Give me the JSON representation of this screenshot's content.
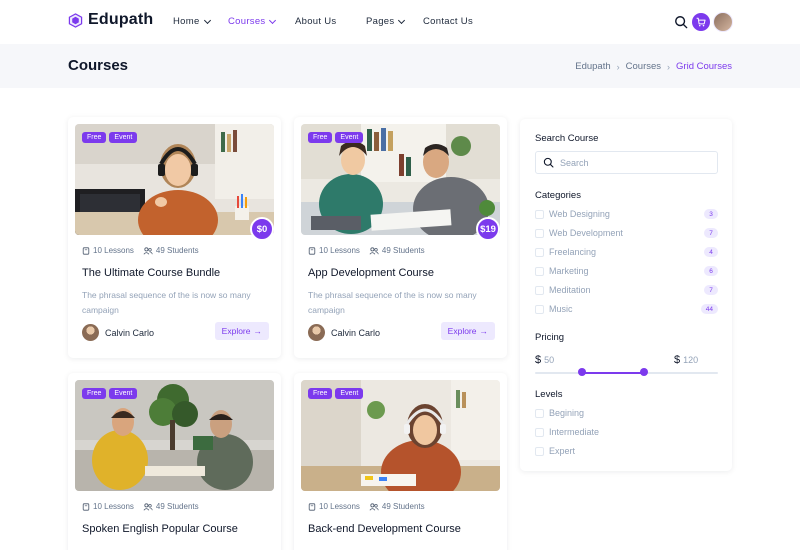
{
  "brand": {
    "name": "Edupath",
    "accent": "#7c3aed"
  },
  "nav": {
    "items": [
      {
        "label": "Home",
        "dropdown": true
      },
      {
        "label": "Courses",
        "dropdown": true,
        "active": true
      },
      {
        "label": "About Us",
        "dropdown": false
      },
      {
        "label": "Pages",
        "dropdown": true
      },
      {
        "label": "Contact Us",
        "dropdown": false
      }
    ],
    "icons": [
      "search-icon",
      "cart-icon",
      "user-avatar"
    ]
  },
  "page": {
    "title": "Courses",
    "breadcrumb": [
      "Edupath",
      "Courses",
      "Grid Courses"
    ]
  },
  "courses": [
    {
      "tags": [
        "Free",
        "Event"
      ],
      "price": "$0",
      "lessons": "10 Lessons",
      "students": "49 Students",
      "title": "The Ultimate Course Bundle",
      "desc": "The phrasal sequence of the is now so many campaign",
      "author": "Calvin Carlo",
      "cta": "Explore"
    },
    {
      "tags": [
        "Free",
        "Event"
      ],
      "price": "$19",
      "lessons": "10 Lessons",
      "students": "49 Students",
      "title": "App Development Course",
      "desc": "The phrasal sequence of the is now so many campaign",
      "author": "Calvin Carlo",
      "cta": "Explore"
    },
    {
      "tags": [
        "Free",
        "Event"
      ],
      "lessons": "10 Lessons",
      "students": "49 Students",
      "title": "Spoken English Popular Course"
    },
    {
      "tags": [
        "Free",
        "Event"
      ],
      "lessons": "10 Lessons",
      "students": "49 Students",
      "title": "Back-end Development Course"
    }
  ],
  "sidebar": {
    "search": {
      "heading": "Search Course",
      "placeholder": "Search"
    },
    "categories": {
      "heading": "Categories",
      "items": [
        {
          "label": "Web Designing",
          "count": "3"
        },
        {
          "label": "Web Development",
          "count": "7"
        },
        {
          "label": "Freelancing",
          "count": "4"
        },
        {
          "label": "Marketing",
          "count": "6"
        },
        {
          "label": "Meditation",
          "count": "7"
        },
        {
          "label": "Music",
          "count": "44"
        }
      ]
    },
    "pricing": {
      "heading": "Pricing",
      "currency": "$",
      "min": "50",
      "max": "120"
    },
    "levels": {
      "heading": "Levels",
      "items": [
        "Begining",
        "Intermediate",
        "Expert"
      ]
    }
  }
}
